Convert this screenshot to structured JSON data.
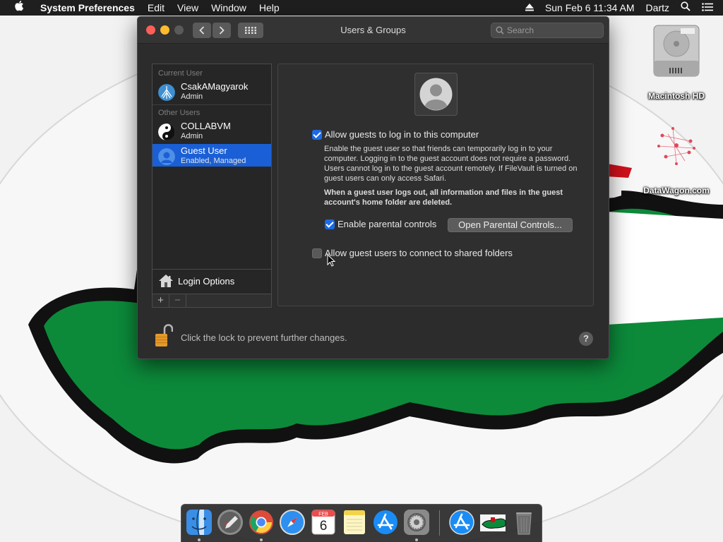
{
  "menubar": {
    "apple_icon": "apple-logo-icon",
    "app_name": "System Preferences",
    "menus": [
      "Edit",
      "View",
      "Window",
      "Help"
    ],
    "datetime": "Sun Feb 6  11:34 AM",
    "user": "Dartz"
  },
  "desktop": {
    "icons": [
      {
        "label": "Macintosh HD",
        "icon": "hard-drive-icon"
      },
      {
        "label": "DataWagon.com",
        "icon": "datawagon-icon"
      }
    ]
  },
  "window": {
    "title": "Users & Groups",
    "search_placeholder": "Search"
  },
  "sidebar": {
    "current_user_label": "Current User",
    "other_users_label": "Other Users",
    "users": [
      {
        "name": "CsakAMagyarok",
        "role": "Admin"
      },
      {
        "name": "COLLABVM",
        "role": "Admin"
      },
      {
        "name": "Guest User",
        "role": "Enabled, Managed",
        "selected": true
      }
    ],
    "login_options": "Login Options",
    "add": "+",
    "remove": "−"
  },
  "panel": {
    "allow_guests_label": "Allow guests to log in to this computer",
    "allow_guests_checked": true,
    "description": "Enable the guest user so that friends can temporarily log in to your computer. Logging in to the guest account does not require a password. Users cannot log in to the guest account remotely. If FileVault is turned on guest users can only access Safari.",
    "description_bold": "When a guest user logs out, all information and files in the guest account's home folder are deleted.",
    "parental_label": "Enable parental controls",
    "parental_checked": true,
    "open_parental_button": "Open Parental Controls...",
    "shared_folders_label": "Allow guest users to connect to shared folders",
    "shared_folders_checked": false
  },
  "footer": {
    "lock_text": "Click the lock to prevent further changes.",
    "help": "?"
  },
  "dock": {
    "apps": [
      "Finder",
      "Launchpad",
      "Google Chrome",
      "Safari",
      "Calendar",
      "Notes",
      "App Store",
      "System Preferences",
      "App Store",
      "Wallpaper",
      "Trash"
    ],
    "calendar_month": "FEB",
    "calendar_day": "6"
  }
}
